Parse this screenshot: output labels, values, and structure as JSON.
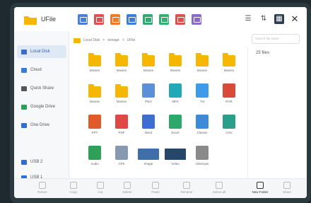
{
  "app": {
    "title": "UFile"
  },
  "toolbar_icons": [
    {
      "name": "blue-doc-icon",
      "color": "#4a7fd6"
    },
    {
      "name": "red-doc-icon",
      "color": "#e05050"
    },
    {
      "name": "orange-doc-icon",
      "color": "#ee7a2a"
    },
    {
      "name": "blue-doc-icon",
      "color": "#3d7dd8"
    },
    {
      "name": "green-doc-icon",
      "color": "#2eab6f"
    },
    {
      "name": "green-doc-icon",
      "color": "#36b070"
    },
    {
      "name": "red-doc-icon",
      "color": "#d9524c"
    },
    {
      "name": "purple-doc-icon",
      "color": "#8a6bc7"
    }
  ],
  "sidebar": {
    "items": [
      {
        "label": "Local Disk",
        "icon": "disk-icon",
        "color": "#3a6cc8",
        "active": true
      },
      {
        "label": "Cloud",
        "icon": "cloud-icon",
        "color": "#3a7bd5"
      },
      {
        "label": "Quick Share",
        "icon": "share-icon",
        "color": "#555555"
      },
      {
        "label": "Google Drive",
        "icon": "google-drive-icon",
        "color": "#2e9e5b"
      },
      {
        "label": "One Drive",
        "icon": "one-drive-icon",
        "color": "#2f6fcf"
      },
      {
        "label": "USB 2",
        "icon": "usb-icon",
        "color": "#2f6fcf"
      },
      {
        "label": "USB 1",
        "icon": "usb-icon",
        "color": "#2f6fcf"
      }
    ]
  },
  "path": {
    "segments": [
      "Local Disk",
      ">",
      "storage",
      ">",
      "UFile"
    ]
  },
  "search": {
    "placeholder": "Search file name"
  },
  "summary": {
    "count": "25 files"
  },
  "files": [
    {
      "label": "Movies",
      "type": "folder",
      "color": "#f5b700"
    },
    {
      "label": "Movies",
      "type": "folder",
      "color": "#f5b700"
    },
    {
      "label": "Movies",
      "type": "folder",
      "color": "#f5b700"
    },
    {
      "label": "Movies",
      "type": "folder",
      "color": "#f5b700"
    },
    {
      "label": "Movies",
      "type": "folder",
      "color": "#f5b700"
    },
    {
      "label": "Movies",
      "type": "folder",
      "color": "#f5b700"
    },
    {
      "label": "Movies",
      "type": "folder",
      "color": "#f5b700"
    },
    {
      "label": "Movies",
      "type": "folder",
      "color": "#f5b700"
    },
    {
      "label": "PNG",
      "type": "file",
      "color": "#5b8fd8"
    },
    {
      "label": "MP4",
      "type": "file",
      "color": "#21a9b8"
    },
    {
      "label": "Txt",
      "type": "file",
      "color": "#3d9be9"
    },
    {
      "label": "RAR",
      "type": "file",
      "color": "#d84b3a"
    },
    {
      "label": "PPT",
      "type": "file",
      "color": "#e05a2a"
    },
    {
      "label": "PDF",
      "type": "file",
      "color": "#e04848"
    },
    {
      "label": "Word",
      "type": "file",
      "color": "#3d6fd0"
    },
    {
      "label": "Excel",
      "type": "file",
      "color": "#2ca86a"
    },
    {
      "label": "Classin",
      "type": "file",
      "color": "#3d8ad8"
    },
    {
      "label": "CSV",
      "type": "file",
      "color": "#2b9f8a"
    },
    {
      "label": "Audio",
      "type": "file",
      "color": "#2fa058"
    },
    {
      "label": "APK",
      "type": "file",
      "color": "#8799b0"
    },
    {
      "label": "Image",
      "type": "thumb",
      "color": "#3f6fa8"
    },
    {
      "label": "Video",
      "type": "thumb",
      "color": "#27466b"
    },
    {
      "label": "Unknown",
      "type": "file",
      "color": "#8a8a8a"
    }
  ],
  "bottom_actions": [
    {
      "label": "Return",
      "enabled": false
    },
    {
      "label": "Copy",
      "enabled": false
    },
    {
      "label": "Cut",
      "enabled": false
    },
    {
      "label": "Delete",
      "enabled": false
    },
    {
      "label": "Paste",
      "enabled": false
    },
    {
      "label": "Rename",
      "enabled": false
    },
    {
      "label": "Select all",
      "enabled": false
    },
    {
      "label": "New Folder",
      "enabled": true
    },
    {
      "label": "Share",
      "enabled": false
    }
  ]
}
